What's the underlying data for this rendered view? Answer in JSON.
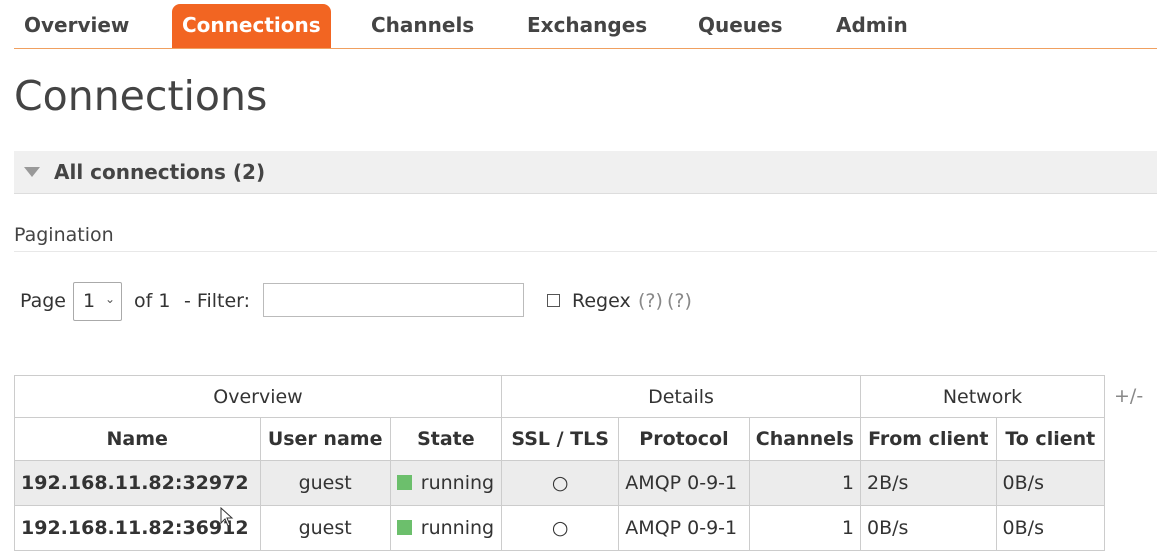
{
  "nav": {
    "items": [
      {
        "label": "Overview",
        "active": false
      },
      {
        "label": "Connections",
        "active": true
      },
      {
        "label": "Channels",
        "active": false
      },
      {
        "label": "Exchanges",
        "active": false
      },
      {
        "label": "Queues",
        "active": false
      },
      {
        "label": "Admin",
        "active": false
      }
    ]
  },
  "page_title": "Connections",
  "section": {
    "title": "All connections (2)",
    "icon": "triangle-down-icon"
  },
  "pagination": {
    "label": "Pagination",
    "page_label": "Page",
    "page_value": "1",
    "of_label": "of 1",
    "filter_label": "- Filter:",
    "filter_value": "",
    "regex_checked": false,
    "regex_label": "Regex",
    "help1": "(?)",
    "help2": "(?)"
  },
  "table": {
    "groups": [
      "Overview",
      "Details",
      "Network"
    ],
    "columns": [
      "Name",
      "User name",
      "State",
      "SSL / TLS",
      "Protocol",
      "Channels",
      "From client",
      "To client"
    ],
    "toggle": "+/-",
    "rows": [
      {
        "name": "192.168.11.82:32972",
        "user": "guest",
        "state": "running",
        "ssl": "○",
        "protocol": "AMQP 0-9-1",
        "channels": "1",
        "from_client": "2B/s",
        "to_client": "0B/s"
      },
      {
        "name": "192.168.11.82:36912",
        "user": "guest",
        "state": "running",
        "ssl": "○",
        "protocol": "AMQP 0-9-1",
        "channels": "1",
        "from_client": "0B/s",
        "to_client": "0B/s"
      }
    ]
  },
  "colors": {
    "accent": "#f26522",
    "running": "#6cbf6c"
  }
}
